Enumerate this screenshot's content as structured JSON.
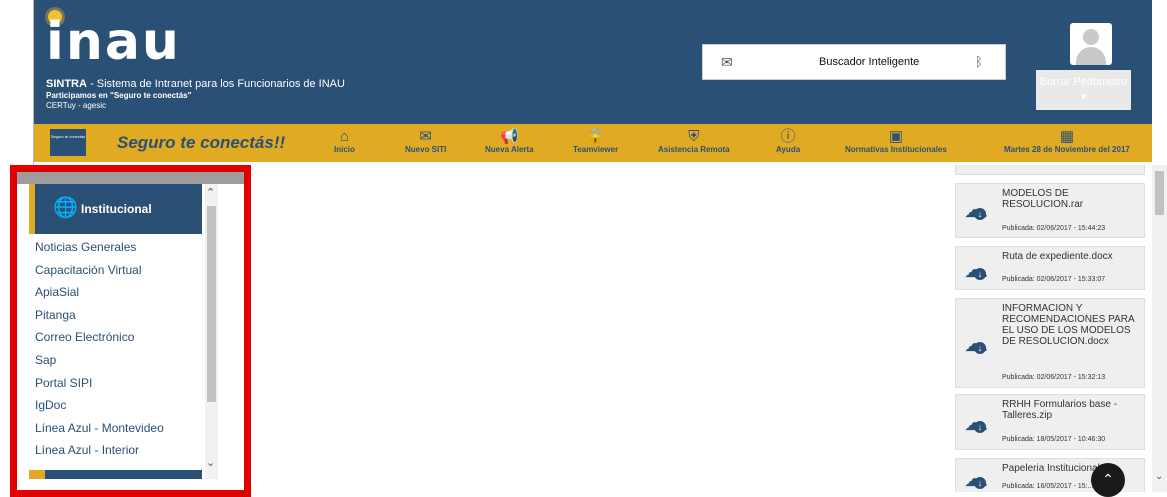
{
  "header": {
    "logo_text": "inau",
    "system_name": "SINTRA",
    "system_desc": " - Sistema de Intranet para los Funcionarios de INAU",
    "participation": "Participamos en \"Seguro te conectás\"",
    "certuy": "CERTuy - agesic",
    "search_label": "Buscador Inteligente",
    "user_button": "Borrar Pedometro ▾"
  },
  "navbar": {
    "logo_caption": "Seguro te conectás",
    "slogan": "Seguro te conectás!!",
    "items": [
      {
        "label": "Inicio",
        "icon": "home-icon"
      },
      {
        "label": "Nuevo SITI",
        "icon": "mail-icon"
      },
      {
        "label": "Nueva Alerta",
        "icon": "megaphone-icon"
      },
      {
        "label": "Teamviewer",
        "icon": "lock-icon"
      },
      {
        "label": "Asistencia Remota",
        "icon": "shield-icon"
      },
      {
        "label": "Ayuda",
        "icon": "info-icon"
      },
      {
        "label": "Normativas Institucionales",
        "icon": "presentation-icon"
      },
      {
        "label": "Martes 28 de Noviembre del 2017",
        "icon": "calendar-icon"
      }
    ]
  },
  "sidebar": {
    "title": "Institucional",
    "items": [
      "Noticias Generales",
      "Capacitación Virtual",
      "ApiaSial",
      "Pitanga",
      "Correo Electrónico",
      "Sap",
      "Portal SIPI",
      "IgDoc",
      "Línea Azul - Montevideo",
      "Línea Azul - Interior"
    ]
  },
  "files": [
    {
      "name": "MODELOS DE RESOLUCION.rar",
      "date": "Publicada: 02/06/2017 - 15:44:23"
    },
    {
      "name": "Ruta de expediente.docx",
      "date": "Publicada: 02/06/2017 - 15:33:07"
    },
    {
      "name": "INFORMACION Y RECOMENDACIONES PARA EL USO DE LOS MODELOS DE RESOLUCION.docx",
      "date": "Publicada: 02/06/2017 - 15:32:13"
    },
    {
      "name": "RRHH Formularios base - Talleres.zip",
      "date": "Publicada: 18/05/2017 - 10:46:30"
    },
    {
      "name": "Papeleria Institucional.zip",
      "date": "Publicada: 16/05/2017 - 15:..."
    }
  ],
  "colors": {
    "header_blue": "#2b5075",
    "accent_gold": "#e0ab23",
    "highlight_red": "#e10000"
  }
}
